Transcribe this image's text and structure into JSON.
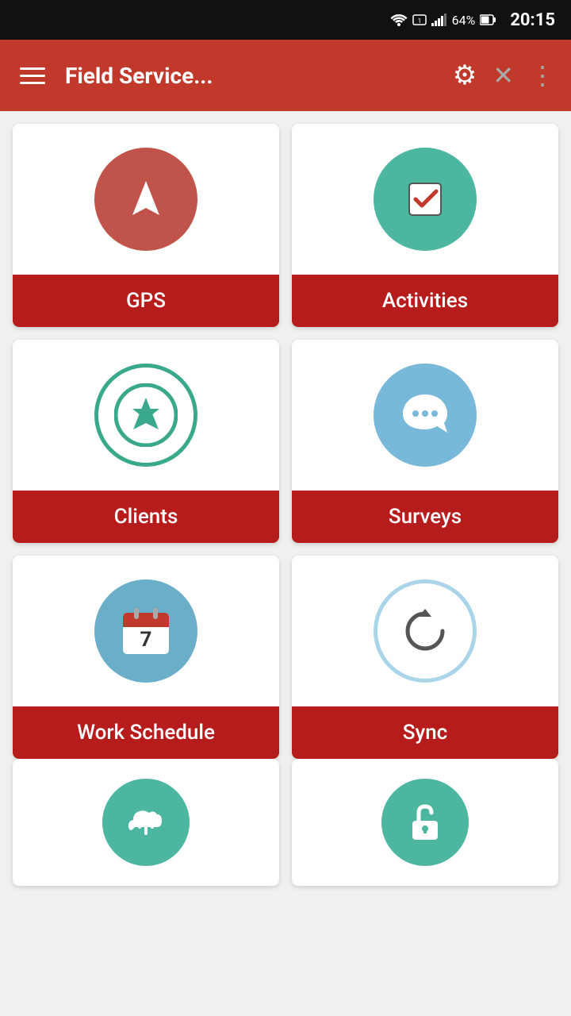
{
  "status_bar": {
    "time": "20:15",
    "battery": "64%",
    "signal": "4G"
  },
  "app_bar": {
    "title": "Field Service...",
    "menu_icon": "☰",
    "settings_icon": "⚙",
    "close_icon": "✕",
    "more_icon": "⋮"
  },
  "cards": [
    {
      "id": "gps",
      "label": "GPS",
      "icon_type": "gps",
      "circle_color": "#c0534a"
    },
    {
      "id": "activities",
      "label": "Activities",
      "icon_type": "activities",
      "circle_color": "#4db6a0"
    },
    {
      "id": "clients",
      "label": "Clients",
      "icon_type": "clients",
      "circle_color": "#3aa88a"
    },
    {
      "id": "surveys",
      "label": "Surveys",
      "icon_type": "surveys",
      "circle_color": "#78b8d8"
    },
    {
      "id": "work-schedule",
      "label": "Work Schedule",
      "icon_type": "calendar",
      "circle_color": "#6aaec8"
    },
    {
      "id": "sync",
      "label": "Sync",
      "icon_type": "sync",
      "circle_color": "none"
    }
  ],
  "bottom_cards": [
    {
      "id": "upload",
      "label": "",
      "icon_type": "upload",
      "circle_color": "#4db6a0"
    },
    {
      "id": "lock",
      "label": "",
      "icon_type": "lock",
      "circle_color": "#4db6a0"
    }
  ]
}
